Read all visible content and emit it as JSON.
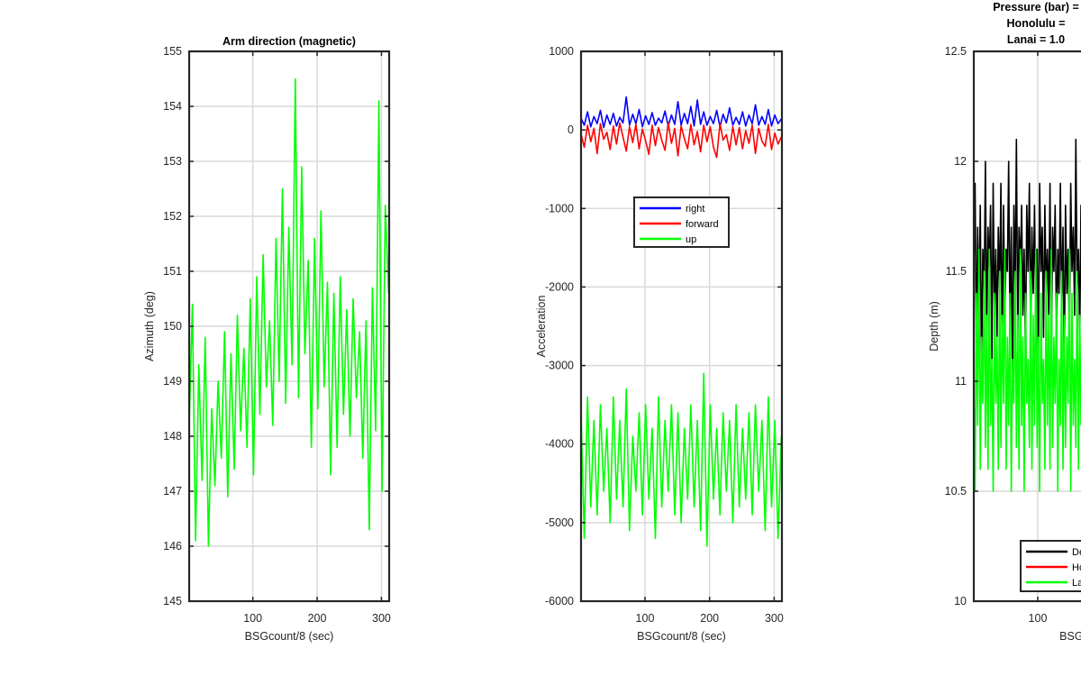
{
  "colors": {
    "green": "#00ff00",
    "blue": "#0000ff",
    "red": "#ff0000",
    "black": "#000000",
    "grid": "#d9d9d9",
    "axis": "#262626"
  },
  "chart_data": [
    {
      "type": "line",
      "title": "Arm direction (magnetic)",
      "xlabel": "BSGcount/8 (sec)",
      "ylabel": "Azimuth (deg)",
      "xlim": [
        1,
        312
      ],
      "ylim": [
        145,
        155
      ],
      "xticks": [
        100,
        200,
        300
      ],
      "xtick_labels": [
        "100",
        "200",
        "300"
      ],
      "yticks": [
        145,
        146,
        147,
        148,
        149,
        150,
        151,
        152,
        153,
        154,
        155
      ],
      "ytick_labels": [
        "145",
        "146",
        "147",
        "148",
        "149",
        "150",
        "151",
        "152",
        "153",
        "154",
        "155"
      ],
      "grid": true,
      "series": [
        {
          "color": "#00ff00",
          "x": [
            1,
            6,
            11,
            16,
            21,
            26,
            31,
            36,
            41,
            46,
            51,
            56,
            61,
            66,
            71,
            76,
            81,
            86,
            91,
            96,
            101,
            106,
            111,
            116,
            121,
            126,
            131,
            136,
            141,
            146,
            151,
            156,
            161,
            166,
            171,
            176,
            181,
            186,
            191,
            196,
            201,
            206,
            211,
            216,
            221,
            226,
            231,
            236,
            241,
            246,
            251,
            256,
            261,
            266,
            271,
            276,
            281,
            286,
            291,
            296,
            301,
            306,
            311
          ],
          "y": [
            148.2,
            150.4,
            146.1,
            149.3,
            147.2,
            149.8,
            146.0,
            148.5,
            147.1,
            149.0,
            147.6,
            149.9,
            146.9,
            149.5,
            147.4,
            150.2,
            148.1,
            149.6,
            147.8,
            150.5,
            147.3,
            150.9,
            148.4,
            151.3,
            148.9,
            150.1,
            148.2,
            151.6,
            149.0,
            152.5,
            148.6,
            151.8,
            149.3,
            154.5,
            148.7,
            152.9,
            149.5,
            151.2,
            147.8,
            151.6,
            148.5,
            152.1,
            148.9,
            150.8,
            147.3,
            150.6,
            147.8,
            150.9,
            148.4,
            150.3,
            148.0,
            150.5,
            148.7,
            149.9,
            147.6,
            150.1,
            146.3,
            150.7,
            148.1,
            154.1,
            147.0,
            152.2,
            150.6
          ]
        }
      ]
    },
    {
      "type": "line",
      "title": "",
      "xlabel": "BSGcount/8 (sec)",
      "ylabel": "Acceleration",
      "xlim": [
        1,
        312
      ],
      "ylim": [
        -6000,
        1000
      ],
      "xticks": [
        100,
        200,
        300
      ],
      "xtick_labels": [
        "100",
        "200",
        "300"
      ],
      "yticks": [
        -6000,
        -5000,
        -4000,
        -3000,
        -2000,
        -1000,
        0,
        1000
      ],
      "ytick_labels": [
        "-6000",
        "-5000",
        "-4000",
        "-3000",
        "-2000",
        "-1000",
        "0",
        "1000"
      ],
      "grid": true,
      "legend": {
        "location": "center",
        "entries": [
          "right",
          "forward",
          "up"
        ]
      },
      "series": [
        {
          "name": "right",
          "color": "#0000ff",
          "x": [
            1,
            6,
            11,
            16,
            21,
            26,
            31,
            36,
            41,
            46,
            51,
            56,
            61,
            66,
            71,
            76,
            81,
            86,
            91,
            96,
            101,
            106,
            111,
            116,
            121,
            126,
            131,
            136,
            141,
            146,
            151,
            156,
            161,
            166,
            171,
            176,
            181,
            186,
            191,
            196,
            201,
            206,
            211,
            216,
            221,
            226,
            231,
            236,
            241,
            246,
            251,
            256,
            261,
            266,
            271,
            276,
            281,
            286,
            291,
            296,
            301,
            306,
            311
          ],
          "y": [
            150,
            60,
            230,
            40,
            170,
            80,
            250,
            30,
            190,
            70,
            210,
            50,
            160,
            90,
            420,
            60,
            200,
            80,
            260,
            40,
            180,
            70,
            220,
            60,
            150,
            90,
            240,
            50,
            190,
            70,
            360,
            60,
            210,
            80,
            300,
            50,
            380,
            70,
            230,
            60,
            170,
            80,
            250,
            40,
            200,
            90,
            280,
            60,
            160,
            70,
            230,
            50,
            190,
            80,
            320,
            60,
            170,
            70,
            260,
            50,
            190,
            80,
            140
          ]
        },
        {
          "name": "forward",
          "color": "#ff0000",
          "x": [
            1,
            6,
            11,
            16,
            21,
            26,
            31,
            36,
            41,
            46,
            51,
            56,
            61,
            66,
            71,
            76,
            81,
            86,
            91,
            96,
            101,
            106,
            111,
            116,
            121,
            126,
            131,
            136,
            141,
            146,
            151,
            156,
            161,
            166,
            171,
            176,
            181,
            186,
            191,
            196,
            201,
            206,
            211,
            216,
            221,
            226,
            231,
            236,
            241,
            246,
            251,
            256,
            261,
            266,
            271,
            276,
            281,
            286,
            291,
            296,
            301,
            306,
            311
          ],
          "y": [
            -50,
            -220,
            60,
            -150,
            20,
            -300,
            80,
            -120,
            -30,
            -250,
            50,
            -180,
            90,
            -90,
            -270,
            40,
            -160,
            70,
            -240,
            10,
            -140,
            -310,
            60,
            -200,
            30,
            -130,
            -260,
            90,
            -170,
            20,
            -330,
            50,
            -110,
            -240,
            70,
            -190,
            -20,
            -280,
            60,
            -150,
            40,
            -220,
            -350,
            80,
            -130,
            -60,
            -260,
            40,
            -190,
            30,
            -240,
            -10,
            -170,
            60,
            -300,
            20,
            -140,
            -210,
            70,
            -250,
            -40,
            -180,
            -90
          ]
        },
        {
          "name": "up",
          "color": "#00ff00",
          "x": [
            1,
            6,
            11,
            16,
            21,
            26,
            31,
            36,
            41,
            46,
            51,
            56,
            61,
            66,
            71,
            76,
            81,
            86,
            91,
            96,
            101,
            106,
            111,
            116,
            121,
            126,
            131,
            136,
            141,
            146,
            151,
            156,
            161,
            166,
            171,
            176,
            181,
            186,
            191,
            196,
            201,
            206,
            211,
            216,
            221,
            226,
            231,
            236,
            241,
            246,
            251,
            256,
            261,
            266,
            271,
            276,
            281,
            286,
            291,
            296,
            301,
            306,
            311
          ],
          "y": [
            -3600,
            -5200,
            -3400,
            -4800,
            -3700,
            -4900,
            -3500,
            -4600,
            -3800,
            -5000,
            -3400,
            -4700,
            -3700,
            -4800,
            -3300,
            -5100,
            -3900,
            -4600,
            -3600,
            -4900,
            -3500,
            -4700,
            -3800,
            -5200,
            -3400,
            -4800,
            -3700,
            -4600,
            -3500,
            -4900,
            -3600,
            -5000,
            -3800,
            -4700,
            -3500,
            -4800,
            -3700,
            -5100,
            -3100,
            -5300,
            -3500,
            -4700,
            -3800,
            -4900,
            -3600,
            -4600,
            -3700,
            -5000,
            -3500,
            -4800,
            -3800,
            -4700,
            -3600,
            -4900,
            -3500,
            -4600,
            -3700,
            -5100,
            -3400,
            -4800,
            -3700,
            -5200,
            -3900
          ]
        }
      ]
    },
    {
      "type": "line",
      "title": "Pressure (bar) =",
      "title_lines": [
        "Pressure (bar) =",
        "Honolulu =",
        "Lanai = 1.0"
      ],
      "xlabel": "BSGc",
      "ylabel": "Depth (m)",
      "xlim": [
        1,
        312
      ],
      "ylim": [
        10,
        12.5
      ],
      "xticks": [
        100
      ],
      "xtick_labels": [
        "100"
      ],
      "yticks": [
        10,
        10.5,
        11,
        11.5,
        12,
        12.5
      ],
      "ytick_labels": [
        "10",
        "10.5",
        "11",
        "11.5",
        "12",
        "12.5"
      ],
      "grid": true,
      "legend": {
        "location": "bottom-right",
        "entries": [
          "De",
          "Ho",
          "La"
        ]
      },
      "series": [
        {
          "name": "De",
          "color": "#000000",
          "x": [
            1,
            3,
            5,
            7,
            9,
            11,
            13,
            15,
            17,
            19,
            21,
            23,
            25,
            27,
            29,
            31,
            33,
            35,
            37,
            39,
            41,
            43,
            45,
            47,
            49,
            51,
            53,
            55,
            57,
            59,
            61,
            63,
            65,
            67,
            69,
            71,
            73,
            75,
            77,
            79,
            81,
            83,
            85,
            87,
            89,
            91,
            93,
            95,
            97,
            99,
            101,
            103,
            105,
            107,
            109,
            111,
            113,
            115,
            117,
            119,
            121,
            123,
            125,
            127,
            129,
            131,
            133,
            135,
            137,
            139,
            141,
            143,
            145,
            147,
            149,
            151,
            153,
            155,
            157,
            159,
            161,
            163,
            165,
            167,
            169,
            171,
            173,
            175
          ],
          "y": [
            11.5,
            11.9,
            11.1,
            11.7,
            11.3,
            11.8,
            11.0,
            11.6,
            11.4,
            12.0,
            11.2,
            11.7,
            11.5,
            11.8,
            11.1,
            11.9,
            11.3,
            11.6,
            11.2,
            11.7,
            11.4,
            11.9,
            11.1,
            11.8,
            11.3,
            11.6,
            11.5,
            12.0,
            11.2,
            11.7,
            11.0,
            11.8,
            11.4,
            12.1,
            11.2,
            11.7,
            11.5,
            11.8,
            11.3,
            11.6,
            11.1,
            11.8,
            11.5,
            11.9,
            11.2,
            11.7,
            11.4,
            11.8,
            11.3,
            11.6,
            11.1,
            11.9,
            11.5,
            11.7,
            11.2,
            11.8,
            11.4,
            11.6,
            11.3,
            11.9,
            11.1,
            11.7,
            11.5,
            11.8,
            11.2,
            11.6,
            11.4,
            11.9,
            11.3,
            11.7,
            11.0,
            11.8,
            11.4,
            11.6,
            11.2,
            11.9,
            11.5,
            11.7,
            11.3,
            12.1,
            11.4,
            11.6,
            11.2,
            11.8,
            11.5,
            11.7,
            11.3,
            11.9
          ]
        },
        {
          "name": "La",
          "color": "#00ff00",
          "x": [
            1,
            3,
            5,
            7,
            9,
            11,
            13,
            15,
            17,
            19,
            21,
            23,
            25,
            27,
            29,
            31,
            33,
            35,
            37,
            39,
            41,
            43,
            45,
            47,
            49,
            51,
            53,
            55,
            57,
            59,
            61,
            63,
            65,
            67,
            69,
            71,
            73,
            75,
            77,
            79,
            81,
            83,
            85,
            87,
            89,
            91,
            93,
            95,
            97,
            99,
            101,
            103,
            105,
            107,
            109,
            111,
            113,
            115,
            117,
            119,
            121,
            123,
            125,
            127,
            129,
            131,
            133,
            135,
            137,
            139,
            141,
            143,
            145,
            147,
            149,
            151,
            153,
            155,
            157,
            159,
            161,
            163,
            165,
            167,
            169,
            171,
            173,
            175
          ],
          "y": [
            11.0,
            10.5,
            11.4,
            10.8,
            11.6,
            10.6,
            11.2,
            10.9,
            11.5,
            10.7,
            11.3,
            10.6,
            11.6,
            10.8,
            11.1,
            10.5,
            11.4,
            10.9,
            11.2,
            10.6,
            11.5,
            10.7,
            11.3,
            10.9,
            11.6,
            10.6,
            11.2,
            10.8,
            11.4,
            10.5,
            11.1,
            10.9,
            11.5,
            10.7,
            11.3,
            10.6,
            11.6,
            10.8,
            11.2,
            10.5,
            11.4,
            10.9,
            11.1,
            10.7,
            11.5,
            10.6,
            11.3,
            10.8,
            11.6,
            10.7,
            11.2,
            10.5,
            11.4,
            10.9,
            11.1,
            10.6,
            11.5,
            10.8,
            11.3,
            10.6,
            11.6,
            10.7,
            11.2,
            10.9,
            11.4,
            10.5,
            11.1,
            10.8,
            11.5,
            10.6,
            11.3,
            10.7,
            11.2,
            10.9,
            11.6,
            10.5,
            11.4,
            10.8,
            11.1,
            10.7,
            11.5,
            10.6,
            11.3,
            10.8,
            11.2,
            10.7,
            11.4,
            10.9
          ]
        }
      ]
    }
  ]
}
